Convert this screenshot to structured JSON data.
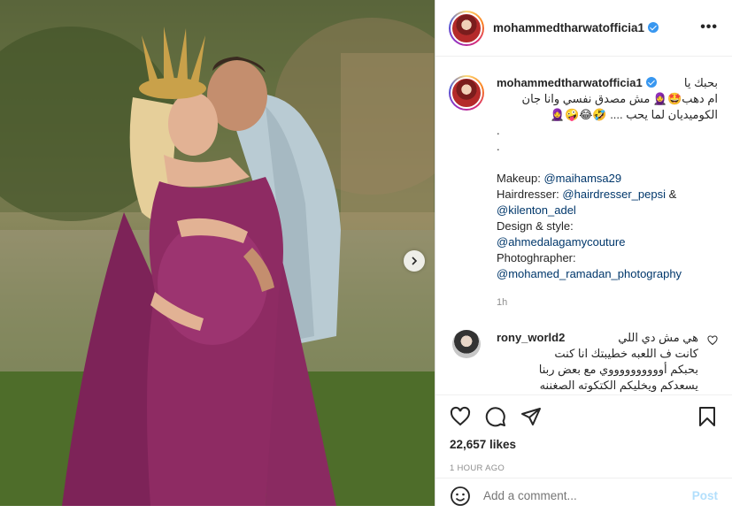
{
  "post": {
    "username": "mohammedtharwatofficia1",
    "verified": true,
    "more_label": "•••"
  },
  "caption": {
    "username": "mohammedtharwatofficia1",
    "arabic_lines": [
      "بحبك يا",
      "ام دهب🤩🧕 مش مصدق نفسي وانا جان",
      "الكوميديان لما يحب .... 🤣😂🤪🧕"
    ],
    "dots": [
      ".",
      "."
    ],
    "credits": [
      {
        "label": "Makeup: ",
        "handle": "@maihamsa29",
        "suffix": ""
      },
      {
        "label": "Hairdresser: ",
        "handle": "@hairdresser_pepsi",
        "suffix": " &"
      },
      {
        "label": "",
        "handle": "@kilenton_adel",
        "suffix": ""
      },
      {
        "label": "Design & style:",
        "handle": "",
        "suffix": ""
      },
      {
        "label": "",
        "handle": "@ahmedalagamycouture",
        "suffix": ""
      },
      {
        "label": "Photoghrapher:",
        "handle": "",
        "suffix": ""
      },
      {
        "label": "",
        "handle": "@mohamed_ramadan_photography",
        "suffix": ""
      }
    ],
    "time": "1h"
  },
  "comment": {
    "username": "rony_world2",
    "lines": [
      "rony_world2 هي مش دي اللي",
      "كانت ف اللعبه خطيبتك انا كنت",
      "بحبكم أووووووووووي مع بعض ربنا",
      "يسعدكم ويخليكم الكتكوته الصغننه"
    ]
  },
  "actions": {
    "likes": "22,657 likes",
    "posted_ago": "1 HOUR AGO"
  },
  "add_comment": {
    "placeholder": "Add a comment...",
    "post_label": "Post"
  },
  "colors": {
    "accent": "#3897f0",
    "link": "#00376b",
    "muted": "#8e8e8e",
    "post_disabled": "#b2dffc",
    "dress": "#8e2b63"
  },
  "icons": [
    "verified-icon",
    "more-options-icon",
    "chevron-right-icon",
    "heart-icon",
    "comment-icon",
    "share-icon",
    "bookmark-icon",
    "emoji-icon"
  ]
}
